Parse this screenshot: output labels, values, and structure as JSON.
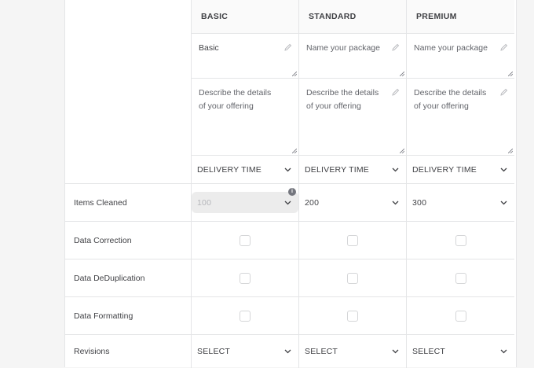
{
  "packages": [
    {
      "header": "BASIC",
      "name": "Basic",
      "name_is_placeholder": false,
      "description": "Describe the details of your offering",
      "delivery": "DELIVERY TIME",
      "items": "100",
      "items_disabled": true,
      "revisions": "SELECT"
    },
    {
      "header": "STANDARD",
      "name": "Name your package",
      "name_is_placeholder": true,
      "description": "Describe the details of your offering",
      "delivery": "DELIVERY TIME",
      "items": "200",
      "items_disabled": false,
      "revisions": "SELECT"
    },
    {
      "header": "PREMIUM",
      "name": "Name your package",
      "name_is_placeholder": true,
      "description": "Describe the details of your offering",
      "delivery": "DELIVERY TIME",
      "items": "300",
      "items_disabled": false,
      "revisions": "SELECT"
    }
  ],
  "rows": {
    "items_cleaned": "Items Cleaned",
    "data_correction": "Data Correction",
    "data_deduplication": "Data DeDuplication",
    "data_formatting": "Data Formatting",
    "revisions": "Revisions"
  },
  "info_glyph": "i",
  "colors": {
    "border": "#e4e5e7",
    "header_bg": "#fafafa",
    "disabled_bg": "#ececec",
    "text": "#404145"
  },
  "icons": [
    "pencil-icon",
    "resize-handle-icon",
    "chevron-down-icon",
    "info-icon"
  ]
}
